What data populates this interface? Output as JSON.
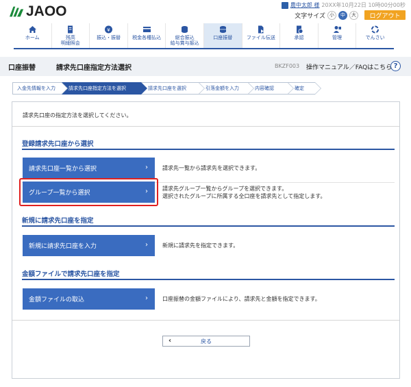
{
  "header": {
    "logo_text": "JAOO",
    "user_name": "農中太郎 様",
    "login_time": "20XX年10月22日 10時00分00秒",
    "font_size_label": "文字サイズ",
    "font_sizes": [
      "小",
      "中",
      "大"
    ],
    "logout_label": "ログアウト"
  },
  "nav": {
    "items": [
      {
        "label": "ホーム",
        "icon": "home-icon"
      },
      {
        "label": "残高\n明細照会",
        "icon": "document-icon"
      },
      {
        "label": "振込・振替",
        "icon": "yen-coin-icon"
      },
      {
        "label": "税金各種払込",
        "icon": "card-icon"
      },
      {
        "label": "総合振込\n給与賞与振込",
        "icon": "coins-icon"
      },
      {
        "label": "口座振替",
        "icon": "coin-stack-icon"
      },
      {
        "label": "ファイル伝送",
        "icon": "file-send-icon"
      },
      {
        "label": "承認",
        "icon": "approve-icon"
      },
      {
        "label": "管理",
        "icon": "admin-icon"
      },
      {
        "label": "でんさい",
        "icon": "densai-icon"
      }
    ]
  },
  "titlebar": {
    "category": "口座振替",
    "title": "請求先口座指定方法選択",
    "screen_id": "BKZF003",
    "help_link": "操作マニュアル／FAQはこちら",
    "help_icon": "?"
  },
  "steps": [
    {
      "label": "入金先情報を入力"
    },
    {
      "label": "請求先口座指定方法を選択"
    },
    {
      "label": "請求先口座を選択"
    },
    {
      "label": "引落金額を入力"
    },
    {
      "label": "内容確認"
    },
    {
      "label": "確定"
    }
  ],
  "main": {
    "intro": "請求先口座の指定方法を選択してください。",
    "section1_title": "登録請求先口座から選択",
    "btn1_label": "請求先口座一覧から選択",
    "btn1_desc": "請求先一覧から請求先を選択できます。",
    "btn2_label": "グループ一覧から選択",
    "btn2_desc_1": "請求先グループ一覧からグループを選択できます。",
    "btn2_desc_2": "選択されたグループに所属する全口座を請求先として指定します。",
    "section2_title": "新規に請求先口座を指定",
    "btn3_label": "新規に請求先口座を入力",
    "btn3_desc": "新規に請求先を指定できます。",
    "section3_title": "金額ファイルで請求先口座を指定",
    "btn4_label": "金額ファイルの取込",
    "btn4_desc": "口座振替の金額ファイルにより、請求先と金額を指定できます。",
    "back_label": "戻る",
    "chevron": "›",
    "back_chevron": "‹"
  },
  "colors": {
    "brand_blue": "#2b56a3",
    "button_blue": "#3a6cc0",
    "logout_orange": "#f1a321",
    "highlight_red": "#e02020"
  }
}
